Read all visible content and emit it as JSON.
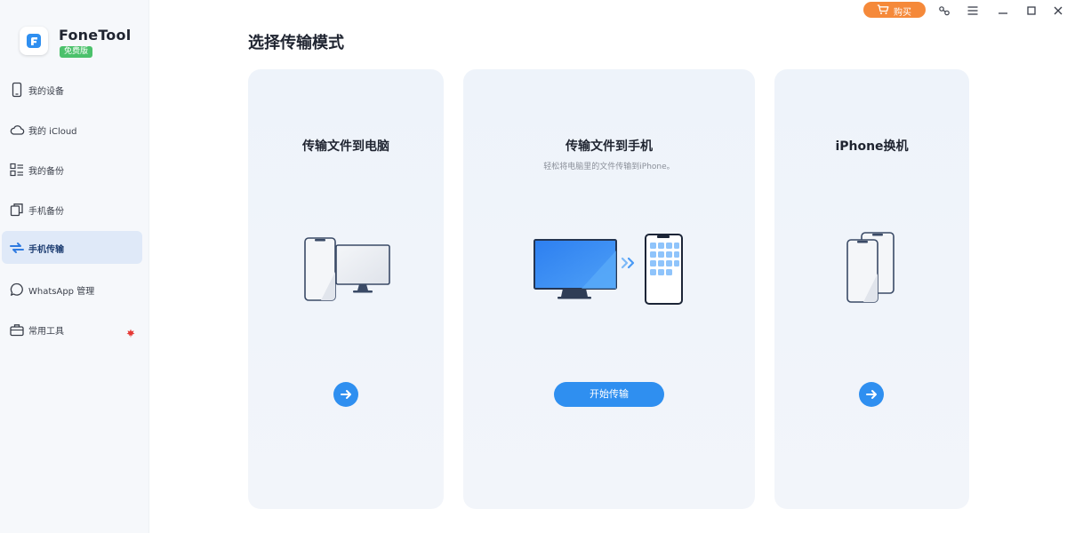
{
  "app": {
    "name": "FoneTool",
    "badge": "免费版"
  },
  "titlebar": {
    "buy_label": "购买"
  },
  "sidebar": {
    "items": [
      {
        "label": "我的设备",
        "icon": "phone-icon",
        "active": false
      },
      {
        "label": "我的 iCloud",
        "icon": "cloud-icon",
        "active": false
      },
      {
        "label": "我的备份",
        "icon": "backup-list-icon",
        "active": false
      },
      {
        "label": "手机备份",
        "icon": "copy-icon",
        "active": false
      },
      {
        "label": "手机传输",
        "icon": "transfer-arrows-icon",
        "active": true
      },
      {
        "label": "WhatsApp 管理",
        "icon": "chat-bubble-icon",
        "active": false
      },
      {
        "label": "常用工具",
        "icon": "toolbox-icon",
        "active": false
      }
    ]
  },
  "main": {
    "title": "选择传输模式",
    "cards": [
      {
        "title": "传输文件到电脑",
        "description": "",
        "illustration": "phone-to-computer-illustration",
        "action": "arrow-right-icon"
      },
      {
        "title": "传输文件到手机",
        "description": "轻松将电脑里的文件传输到iPhone。",
        "illustration": "computer-to-phone-illustration",
        "action_label": "开始传输"
      },
      {
        "title": "iPhone换机",
        "description": "",
        "illustration": "phone-to-phone-illustration",
        "action": "arrow-right-icon"
      }
    ]
  },
  "colors": {
    "accent": "#2f8ff0",
    "buy": "#f5893a",
    "badge": "#4bc16b",
    "active_nav": "#dfe9f8",
    "card_bg": "#eef3fa",
    "alert_dot": "#e53935"
  }
}
